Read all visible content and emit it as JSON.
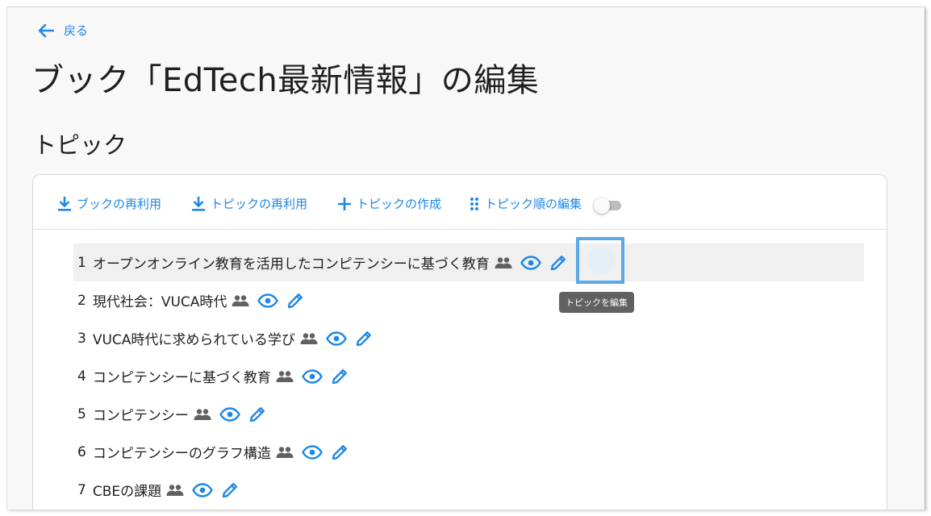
{
  "nav": {
    "back_label": "戻る"
  },
  "page": {
    "title": "ブック「EdTech最新情報」の編集",
    "section_title": "トピック"
  },
  "toolbar": {
    "reuse_book": "ブックの再利用",
    "reuse_topic": "トピックの再利用",
    "create_topic": "トピックの作成",
    "reorder_topics": "トピック順の編集",
    "reorder_toggle_on": false
  },
  "topics": [
    {
      "num": "1",
      "title": "オープンオンライン教育を活用したコンピテンシーに基づく教育"
    },
    {
      "num": "2",
      "title": "現代社会：VUCA時代"
    },
    {
      "num": "3",
      "title": "VUCA時代に求められている学び"
    },
    {
      "num": "4",
      "title": "コンピテンシーに基づく教育"
    },
    {
      "num": "5",
      "title": "コンピテンシー"
    },
    {
      "num": "6",
      "title": "コンピテンシーのグラフ構造"
    },
    {
      "num": "7",
      "title": "CBEの課題"
    }
  ],
  "tooltip": {
    "text": "トピックを編集"
  },
  "icons": {
    "back": "arrow-left-icon",
    "download": "download-icon",
    "add": "plus-icon",
    "drag": "drag-dots-icon",
    "group": "people-icon",
    "view": "eye-icon",
    "edit": "pencil-icon"
  },
  "colors": {
    "accent": "#1e88e5",
    "icon_gray": "#616161",
    "highlight_box": "#5aa9e6",
    "tooltip_bg": "#616161",
    "hover_row": "#f0f0f0",
    "frame_bg": "#f8f8f8"
  }
}
